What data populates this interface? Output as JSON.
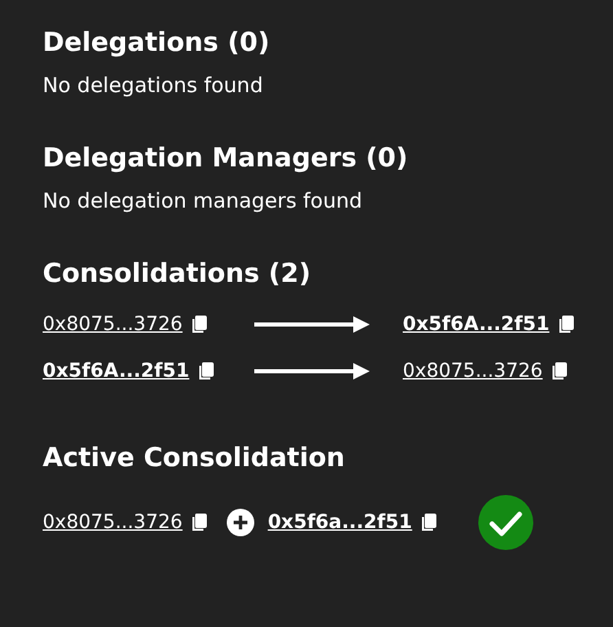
{
  "delegations": {
    "title": "Delegations (0)",
    "empty_text": "No delegations found"
  },
  "delegation_managers": {
    "title": "Delegation Managers (0)",
    "empty_text": "No delegation managers found"
  },
  "consolidations": {
    "title": "Consolidations (2)",
    "rows": [
      {
        "source": {
          "address": "0x8075...3726",
          "emphasized": false
        },
        "target": {
          "address": "0x5f6A...2f51",
          "emphasized": true
        }
      },
      {
        "source": {
          "address": "0x5f6A...2f51",
          "emphasized": true
        },
        "target": {
          "address": "0x8075...3726",
          "emphasized": false
        }
      }
    ]
  },
  "active_consolidation": {
    "title": "Active Consolidation",
    "source": {
      "address": "0x8075...3726",
      "emphasized": false
    },
    "target": {
      "address": "0x5f6a...2f51",
      "emphasized": true
    },
    "complete": true
  }
}
